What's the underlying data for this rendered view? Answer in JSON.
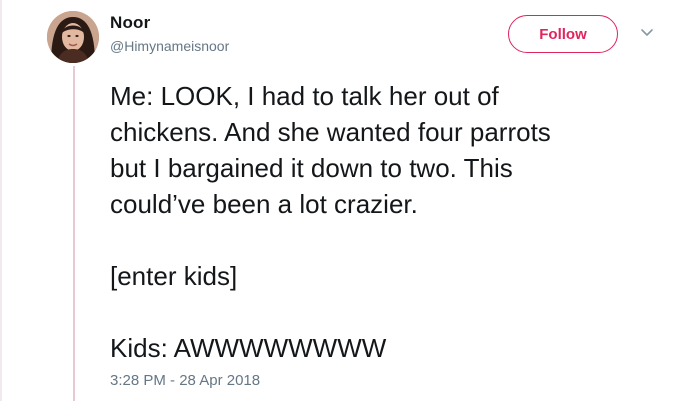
{
  "user": {
    "name": "Noor",
    "handle": "@Himynameisnoor",
    "avatar_icon": "profile-photo"
  },
  "follow_button": {
    "label": "Follow",
    "color": "#e0245e"
  },
  "menu_icon": "chevron-down-icon",
  "tweet": {
    "lines": [
      "Me: LOOK, I had to talk her out of",
      "chickens. And she wanted four parrots",
      "but I bargained it down to two. This",
      "could’ve been a lot crazier."
    ],
    "aside": "[enter kids]",
    "kids_line": "Kids: AWWWWWWWW"
  },
  "timestamp": "3:28 PM - 28 Apr 2018",
  "colors": {
    "text": "#14171a",
    "secondary": "#657786",
    "accent": "#e0245e"
  }
}
